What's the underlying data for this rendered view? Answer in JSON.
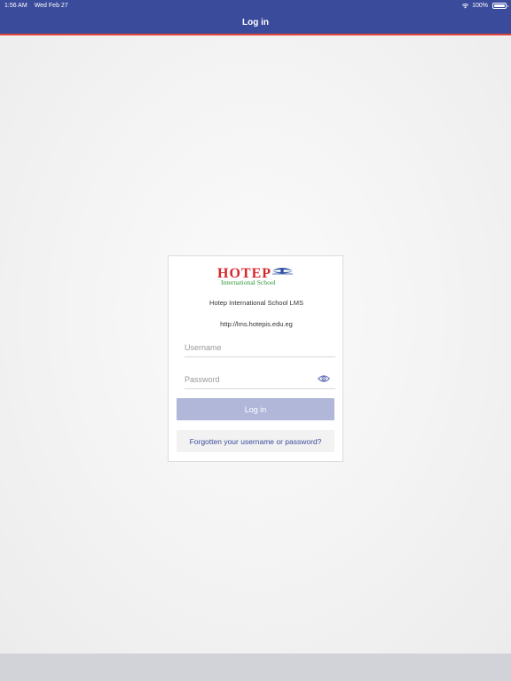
{
  "status_bar": {
    "time": "1:56 AM",
    "date": "Wed Feb 27",
    "battery": "100%",
    "icons": [
      "wifi-icon",
      "battery-icon"
    ]
  },
  "nav": {
    "title": "Log in"
  },
  "card": {
    "logo_text_main": "HOTEP",
    "logo_text_sub": "International School",
    "site_name": "Hotep International School LMS",
    "site_url": "http://lms.hotepis.edu.eg",
    "username_placeholder": "Username",
    "username_value": "",
    "password_placeholder": "Password",
    "password_value": "",
    "login_label": "Log in",
    "forgot_label": "Forgotten your username or password?"
  },
  "colors": {
    "nav_bg": "#3a4b9c",
    "nav_accent": "#e0483a",
    "login_button": "#b0b7d9",
    "link": "#3a4b9c",
    "logo_red": "#d8262c",
    "logo_green": "#2e9a3a",
    "logo_blue": "#2b4fa3"
  }
}
